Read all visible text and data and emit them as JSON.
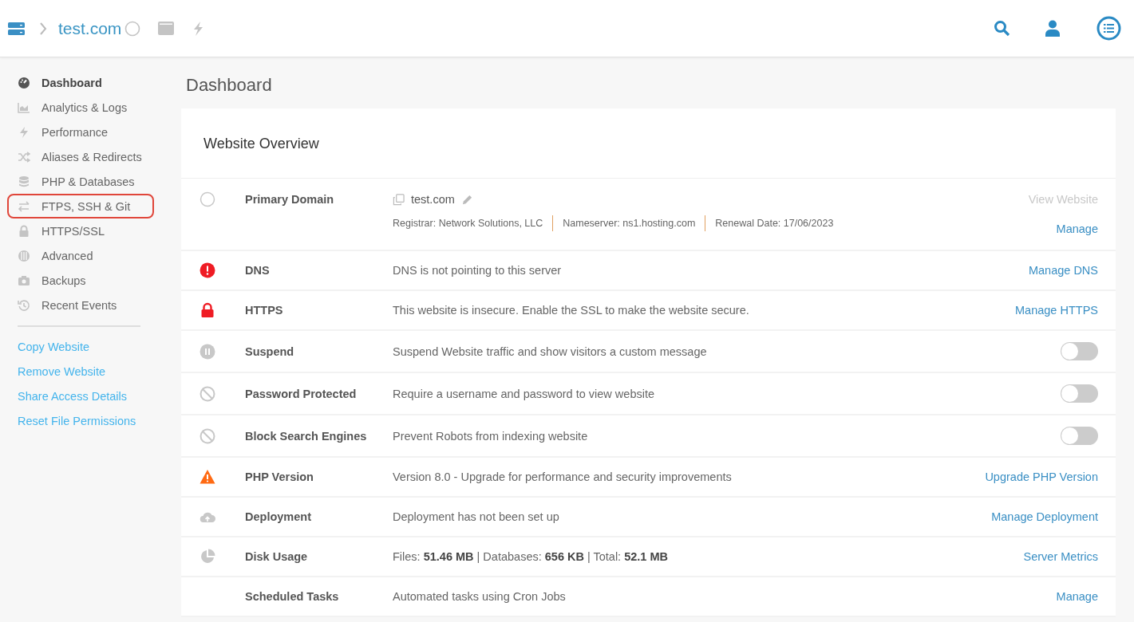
{
  "header": {
    "breadcrumb": "test.com"
  },
  "sidebar": {
    "items": [
      {
        "label": "Dashboard",
        "selected": true,
        "highlighted": false
      },
      {
        "label": "Analytics & Logs",
        "selected": false,
        "highlighted": false
      },
      {
        "label": "Performance",
        "selected": false,
        "highlighted": false
      },
      {
        "label": "Aliases & Redirects",
        "selected": false,
        "highlighted": false
      },
      {
        "label": "PHP & Databases",
        "selected": false,
        "highlighted": false
      },
      {
        "label": "FTPS, SSH & Git",
        "selected": false,
        "highlighted": true
      },
      {
        "label": "HTTPS/SSL",
        "selected": false,
        "highlighted": false
      },
      {
        "label": "Advanced",
        "selected": false,
        "highlighted": false
      },
      {
        "label": "Backups",
        "selected": false,
        "highlighted": false
      },
      {
        "label": "Recent Events",
        "selected": false,
        "highlighted": false
      }
    ],
    "links": [
      "Copy Website",
      "Remove Website",
      "Share Access Details",
      "Reset File Permissions"
    ]
  },
  "page_title": "Dashboard",
  "card": {
    "title": "Website Overview",
    "rows": [
      {
        "kind": "primary",
        "label": "Primary Domain",
        "domain": "test.com",
        "meta": [
          "Registrar: Network Solutions, LLC",
          "Nameserver: ns1.hosting.com",
          "Renewal Date: 17/06/2023"
        ],
        "actions": [
          {
            "label": "View Website",
            "disabled": true
          },
          {
            "label": "Manage",
            "disabled": false
          }
        ]
      },
      {
        "kind": "link",
        "label": "DNS",
        "description": "DNS is not pointing to this server",
        "action": "Manage DNS"
      },
      {
        "kind": "link",
        "label": "HTTPS",
        "description": "This website is insecure. Enable the SSL to make the website secure.",
        "action": "Manage HTTPS"
      },
      {
        "kind": "toggle",
        "label": "Suspend",
        "description": "Suspend Website traffic and show visitors a custom message",
        "on": false
      },
      {
        "kind": "toggle",
        "label": "Password Protected",
        "description": "Require a username and password to view website",
        "on": false
      },
      {
        "kind": "toggle",
        "label": "Block Search Engines",
        "description": "Prevent Robots from indexing website",
        "on": false
      },
      {
        "kind": "link",
        "label": "PHP Version",
        "description": "Version 8.0 - Upgrade for performance and security improvements",
        "action": "Upgrade PHP Version"
      },
      {
        "kind": "link",
        "label": "Deployment",
        "description": "Deployment has not been set up",
        "action": "Manage Deployment"
      },
      {
        "kind": "link",
        "label": "Disk Usage",
        "description": "Files: **51.46 MB** | Databases: **656 KB** | Total: **52.1 MB**",
        "action": "Server Metrics"
      },
      {
        "kind": "link",
        "label": "Scheduled Tasks",
        "description": "Automated tasks using Cron Jobs",
        "action": "Manage"
      }
    ]
  }
}
